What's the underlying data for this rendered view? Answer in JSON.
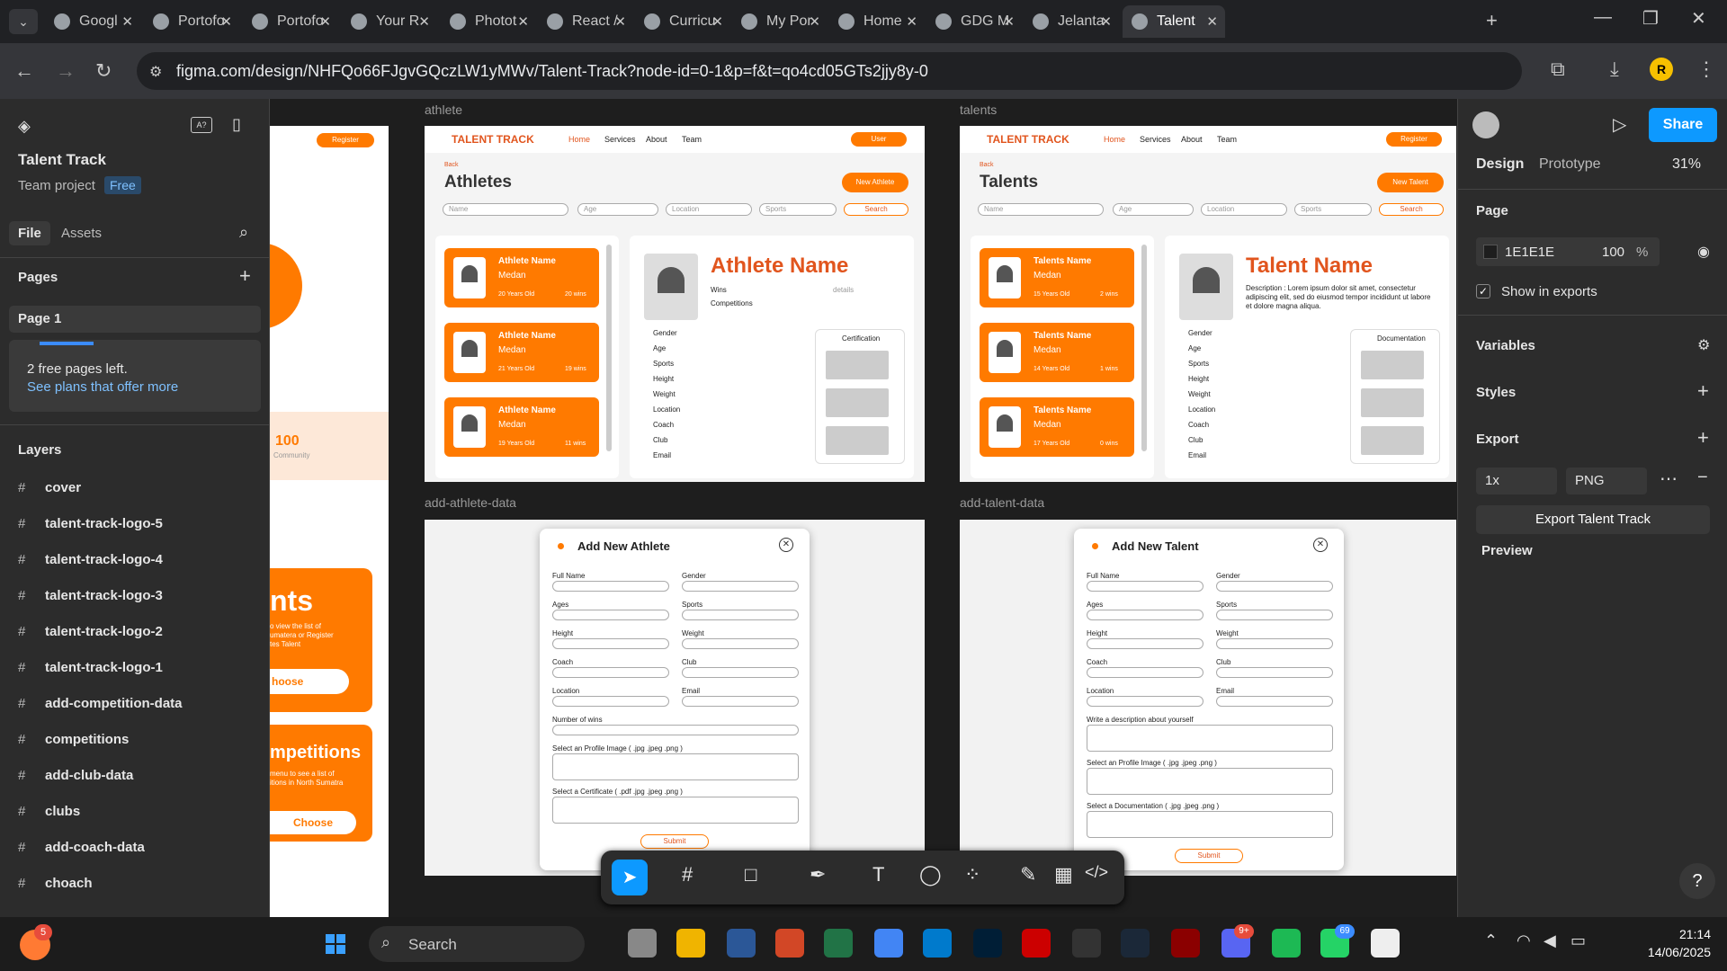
{
  "browser": {
    "tabs": [
      "Googl",
      "Portofo",
      "Portofo",
      "Your R",
      "Photot",
      "React /",
      "Curricu",
      "My Por",
      "Home",
      "GDG M",
      "Jelanta",
      "Talent"
    ],
    "url": "figma.com/design/NHFQo66FJgvGQczLW1yMWv/Talent-Track?node-id=0-1&p=f&t=qo4cd05GTs2jjy8y-0",
    "profile": "R"
  },
  "left": {
    "file_name": "Talent Track",
    "team": "Team project",
    "plan": "Free",
    "tab_file": "File",
    "tab_assets": "Assets",
    "pages_title": "Pages",
    "page1": "Page 1",
    "free_left": "2 free pages left.",
    "see_plans": "See plans that offer more",
    "layers_title": "Layers",
    "layers": [
      "cover",
      "talent-track-logo-5",
      "talent-track-logo-4",
      "talent-track-logo-3",
      "talent-track-logo-2",
      "talent-track-logo-1",
      "add-competition-data",
      "competitions",
      "add-club-data",
      "clubs",
      "add-coach-data",
      "choach"
    ]
  },
  "right": {
    "share": "Share",
    "design": "Design",
    "prototype": "Prototype",
    "zoom": "31%",
    "page": "Page",
    "color": "1E1E1E",
    "opacity": "100",
    "pct": "%",
    "show_exports": "Show in exports",
    "variables": "Variables",
    "styles": "Styles",
    "export": "Export",
    "scale": "1x",
    "format": "PNG",
    "export_btn": "Export Talent Track",
    "preview": "Preview"
  },
  "canvas": {
    "athlete": {
      "label": "athlete",
      "logo": "TALENT TRACK",
      "nav": [
        "Home",
        "Services",
        "About",
        "Team"
      ],
      "user": "User",
      "back": "Back",
      "title": "Athletes",
      "new": "New Athlete",
      "f_name": "Name",
      "f_age": "Age",
      "f_loc": "Location",
      "f_sports": "Sports",
      "search": "Search",
      "card_name": "Athlete Name",
      "card_city": "Medan",
      "cards": [
        {
          "age": "20 Years Old",
          "wins": "20 wins"
        },
        {
          "age": "21 Years Old",
          "wins": "19 wins"
        },
        {
          "age": "19 Years Old",
          "wins": "11 wins"
        }
      ],
      "detail_name": "Athlete Name",
      "wins": "Wins",
      "comps": "Competitions",
      "details": "details",
      "cert": "Certification",
      "fields": [
        "Gender",
        "Age",
        "Sports",
        "Height",
        "Weight",
        "Location",
        "Coach",
        "Club",
        "Email"
      ]
    },
    "talents": {
      "label": "talents",
      "logo": "TALENT TRACK",
      "nav": [
        "Home",
        "Services",
        "About",
        "Team"
      ],
      "register": "Register",
      "back": "Back",
      "title": "Talents",
      "new": "New Talent",
      "f_name": "Name",
      "f_age": "Age",
      "f_loc": "Location",
      "f_sports": "Sports",
      "search": "Search",
      "card_name": "Talents Name",
      "card_city": "Medan",
      "cards": [
        {
          "age": "15 Years Old",
          "wins": "2 wins"
        },
        {
          "age": "14 Years Old",
          "wins": "1 wins"
        },
        {
          "age": "17 Years Old",
          "wins": "0 wins"
        }
      ],
      "detail_name": "Talent Name",
      "desc": "Description : Lorem ipsum dolor sit amet, consectetur adipiscing elit, sed do eiusmod tempor incididunt ut labore et dolore magna aliqua.",
      "doc": "Documentation",
      "fields": [
        "Gender",
        "Age",
        "Sports",
        "Height",
        "Weight",
        "Location",
        "Coach",
        "Club",
        "Email"
      ]
    },
    "add_athlete": {
      "label": "add-athlete-data",
      "title": "Add New Athlete",
      "full": "Full Name",
      "gender": "Gender",
      "ages": "Ages",
      "sports": "Sports",
      "height": "Height",
      "weight": "Weight",
      "coach": "Coach",
      "club": "Club",
      "location": "Location",
      "email": "Email",
      "nwins": "Number of wins",
      "profile": "Select an Profile Image ( .jpg .jpeg .png )",
      "cert": "Select a Certificate ( .pdf .jpg .jpeg .png )",
      "submit": "Submit"
    },
    "add_talent": {
      "label": "add-talent-data",
      "title": "Add New Talent",
      "full": "Full Name",
      "gender": "Gender",
      "ages": "Ages",
      "sports": "Sports",
      "height": "Height",
      "weight": "Weight",
      "coach": "Coach",
      "club": "Club",
      "location": "Location",
      "email": "Email",
      "desc": "Write a description about yourself",
      "profile": "Select an Profile Image ( .jpg .jpeg .png )",
      "docs": "Select a Documentation ( .jpg .jpeg .png )",
      "submit": "Submit"
    },
    "cover": {
      "register": "Register",
      "num": "100",
      "community": "Community",
      "nts": "nts",
      "mpetitions": "mpetitions",
      "choose": "Choose",
      "hoose": "hoose",
      "t1": "o view the list of",
      "t2": "umatera or Register",
      "t3": "tes Talent",
      "t4": "menu to see a list of",
      "t5": "itions in North Sumatra"
    }
  },
  "taskbar": {
    "search": "Search",
    "time": "21:14",
    "date": "14/06/2025",
    "badge_chrome": "5",
    "badge_discord": "9+",
    "badge_wa": "69"
  },
  "accent": "#ff7a00"
}
